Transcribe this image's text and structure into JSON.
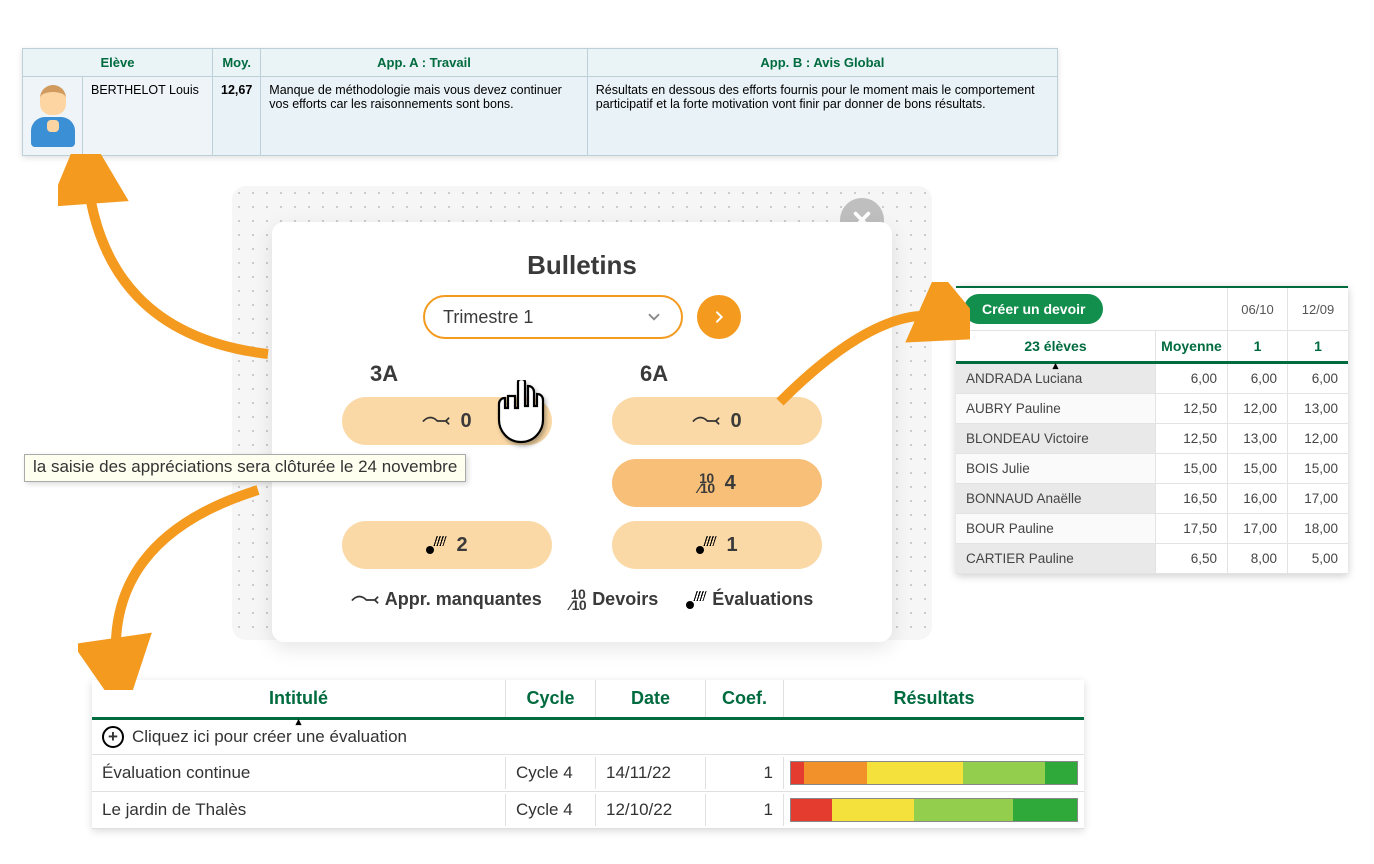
{
  "colors": {
    "green": "#006b3f",
    "orange_accent": "#f39a1f"
  },
  "student_table": {
    "headers": {
      "eleve": "Elève",
      "moy": "Moy.",
      "appA": "App. A : Travail",
      "appB": "App. B : Avis Global"
    },
    "row": {
      "name": "BERTHELOT Louis",
      "moy": "12,67",
      "appA": "Manque de méthodologie mais vous devez continuer vos efforts car les raisonnements sont bons.",
      "appB": "Résultats en dessous des efforts fournis pour le moment mais le comportement participatif et la forte motivation vont finir par donner de bons résultats."
    }
  },
  "bulletin": {
    "title": "Bulletins",
    "trimestre": "Trimestre 1",
    "classes": [
      {
        "name": "3A",
        "missing": "0",
        "devoirs": null,
        "evals": "2"
      },
      {
        "name": "6A",
        "missing": "0",
        "devoirs": "4",
        "evals": "1"
      }
    ],
    "legend": {
      "missing": "Appr. manquantes",
      "devoirs": "Devoirs",
      "evals": "Évaluations"
    },
    "tooltip": "la saisie des appréciations sera clôturée le 24 novembre"
  },
  "grades": {
    "create_btn": "Créer un devoir",
    "dates": [
      "06/10",
      "12/09"
    ],
    "students_count": "23 élèves",
    "moyenne": "Moyenne",
    "d1": "1",
    "d2": "1",
    "rows": [
      {
        "name": "ANDRADA Luciana",
        "moy": "6,00",
        "g1": "6,00",
        "g2": "6,00"
      },
      {
        "name": "AUBRY Pauline",
        "moy": "12,50",
        "g1": "12,00",
        "g2": "13,00"
      },
      {
        "name": "BLONDEAU Victoire",
        "moy": "12,50",
        "g1": "13,00",
        "g2": "12,00"
      },
      {
        "name": "BOIS Julie",
        "moy": "15,00",
        "g1": "15,00",
        "g2": "15,00"
      },
      {
        "name": "BONNAUD Anaëlle",
        "moy": "16,50",
        "g1": "16,00",
        "g2": "17,00"
      },
      {
        "name": "BOUR Pauline",
        "moy": "17,50",
        "g1": "17,00",
        "g2": "18,00"
      },
      {
        "name": "CARTIER Pauline",
        "moy": "6,50",
        "g1": "8,00",
        "g2": "5,00"
      }
    ]
  },
  "evaluations": {
    "headers": {
      "intitule": "Intitulé",
      "cycle": "Cycle",
      "date": "Date",
      "coef": "Coef.",
      "resultats": "Résultats"
    },
    "add_text": "Cliquez ici pour créer une évaluation",
    "rows": [
      {
        "intitule": "Évaluation continue",
        "cycle": "Cycle 4",
        "date": "14/11/22",
        "coef": "1",
        "segments": [
          [
            "#e43c2e",
            4
          ],
          [
            "#f2902a",
            20
          ],
          [
            "#f5e13c",
            30
          ],
          [
            "#93cf4c",
            26
          ],
          [
            "#2faa3a",
            10
          ]
        ]
      },
      {
        "intitule": "Le jardin de Thalès",
        "cycle": "Cycle 4",
        "date": "12/10/22",
        "coef": "1",
        "segments": [
          [
            "#e43c2e",
            14
          ],
          [
            "#f5e13c",
            28
          ],
          [
            "#93cf4c",
            34
          ],
          [
            "#2faa3a",
            22
          ]
        ]
      }
    ]
  }
}
